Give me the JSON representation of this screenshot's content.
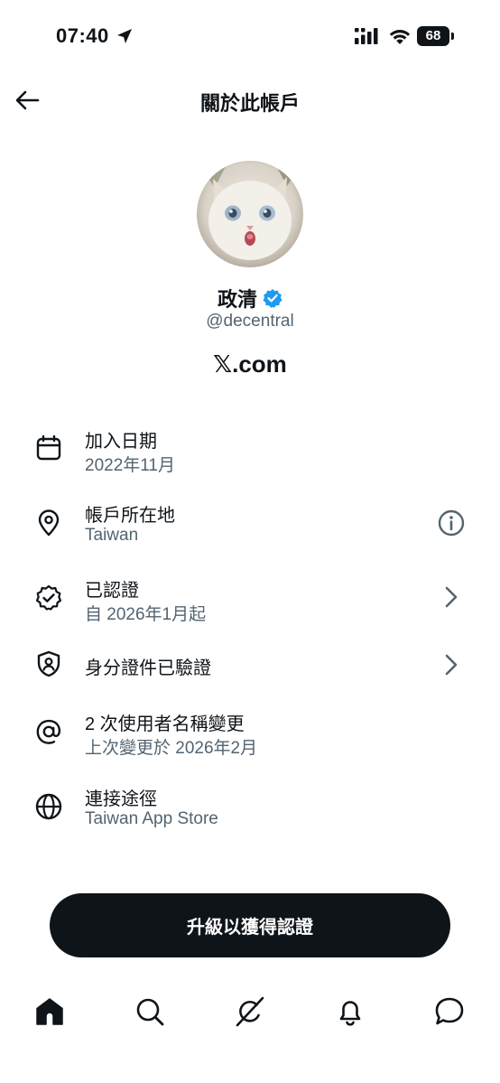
{
  "status_bar": {
    "time": "07:40",
    "battery": "68"
  },
  "header": {
    "title": "關於此帳戶"
  },
  "profile": {
    "name": "政清",
    "handle": "@decentral",
    "domain": "𝕏.com"
  },
  "info_rows": [
    {
      "icon": "calendar-icon",
      "title": "加入日期",
      "subtitle": "2022年11月"
    },
    {
      "icon": "location-pin-icon",
      "title": "帳戶所在地",
      "subtitle": "Taiwan",
      "action": "info-icon"
    },
    {
      "icon": "verified-badge-icon",
      "title": "已認證",
      "subtitle": "自 2026年1月起",
      "action": "chevron-right-icon"
    },
    {
      "icon": "id-shield-icon",
      "title": "身分證件已驗證",
      "action": "chevron-right-icon"
    },
    {
      "icon": "at-sign-icon",
      "title": "2 次使用者名稱變更",
      "subtitle": "上次變更於 2026年2月"
    },
    {
      "icon": "globe-icon",
      "title": "連接途徑",
      "subtitle": "Taiwan App Store"
    }
  ],
  "cta": {
    "label": "升級以獲得認證"
  },
  "tabs": [
    "home-icon",
    "search-icon",
    "grok-icon",
    "notifications-icon",
    "messages-icon"
  ],
  "colors": {
    "text": "#0f1419",
    "secondary": "#536471",
    "verified": "#1d9bf0",
    "button_bg": "#0f1419"
  }
}
